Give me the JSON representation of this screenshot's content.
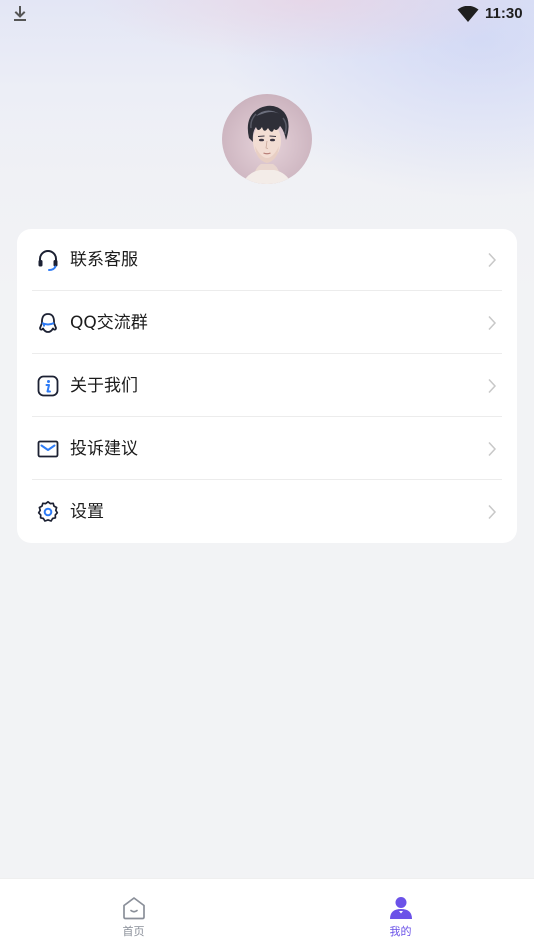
{
  "status_bar": {
    "time": "11:30",
    "download_icon": "download-icon",
    "wifi_icon": "wifi-icon"
  },
  "profile": {
    "avatar": "avatar"
  },
  "menu": {
    "items": [
      {
        "label": "联系客服",
        "icon": "headset-icon"
      },
      {
        "label": "QQ交流群",
        "icon": "qq-icon"
      },
      {
        "label": "关于我们",
        "icon": "info-icon"
      },
      {
        "label": "投诉建议",
        "icon": "mail-icon"
      },
      {
        "label": "设置",
        "icon": "gear-icon"
      }
    ]
  },
  "tab_bar": {
    "tabs": [
      {
        "label": "首页",
        "icon": "home-icon",
        "active": false
      },
      {
        "label": "我的",
        "icon": "person-icon",
        "active": true
      }
    ],
    "active_color": "#6b52e8",
    "inactive_color": "#8a8f99"
  },
  "colors": {
    "accent": "#6b52e8",
    "icon_blue": "#2f7cf6",
    "icon_dark": "#1c2133"
  }
}
